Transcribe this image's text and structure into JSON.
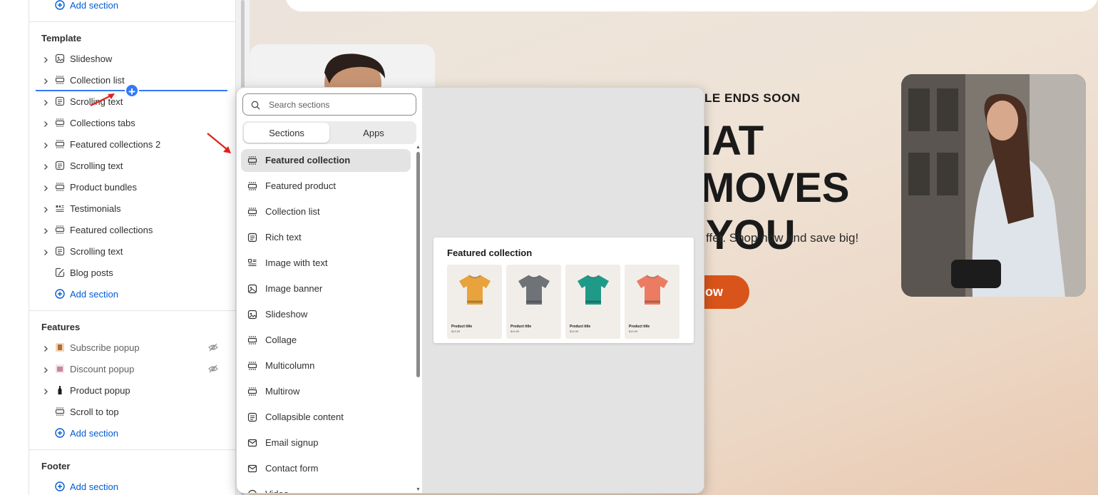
{
  "sidebar": {
    "top_add": "Add section",
    "template_heading": "Template",
    "template_items": [
      {
        "label": "Slideshow",
        "icon": "slideshow-icon"
      },
      {
        "label": "Collection list",
        "icon": "collection-list-icon"
      },
      {
        "label": "Scrolling text",
        "icon": "text-icon"
      },
      {
        "label": "Collections tabs",
        "icon": "collection-list-icon"
      },
      {
        "label": "Featured collections 2",
        "icon": "collection-list-icon"
      },
      {
        "label": "Scrolling text",
        "icon": "text-icon"
      },
      {
        "label": "Product bundles",
        "icon": "collection-list-icon"
      },
      {
        "label": "Testimonials",
        "icon": "testimonials-icon"
      },
      {
        "label": "Featured collections",
        "icon": "collection-list-icon"
      },
      {
        "label": "Scrolling text",
        "icon": "text-icon"
      },
      {
        "label": "Blog posts",
        "icon": "blog-icon"
      }
    ],
    "template_add": "Add section",
    "features_heading": "Features",
    "features_items": [
      {
        "label": "Subscribe popup",
        "hidden": true
      },
      {
        "label": "Discount popup",
        "hidden": true
      },
      {
        "label": "Product popup",
        "hidden": false
      },
      {
        "label": "Scroll to top",
        "hidden": false
      }
    ],
    "features_add": "Add section",
    "footer_heading": "Footer",
    "footer_add": "Add section"
  },
  "popup": {
    "search_placeholder": "Search sections",
    "tabs": [
      "Sections",
      "Apps"
    ],
    "items": [
      {
        "label": "Featured collection",
        "icon": "collection-icon"
      },
      {
        "label": "Featured product",
        "icon": "collection-icon"
      },
      {
        "label": "Collection list",
        "icon": "collection-icon"
      },
      {
        "label": "Rich text",
        "icon": "text-icon"
      },
      {
        "label": "Image with text",
        "icon": "image-text-icon"
      },
      {
        "label": "Image banner",
        "icon": "image-icon"
      },
      {
        "label": "Slideshow",
        "icon": "slideshow-icon"
      },
      {
        "label": "Collage",
        "icon": "collection-icon"
      },
      {
        "label": "Multicolumn",
        "icon": "collection-icon"
      },
      {
        "label": "Multirow",
        "icon": "collection-icon"
      },
      {
        "label": "Collapsible content",
        "icon": "text-icon"
      },
      {
        "label": "Email signup",
        "icon": "email-icon"
      },
      {
        "label": "Contact form",
        "icon": "email-icon"
      },
      {
        "label": "Video",
        "icon": "video-icon"
      }
    ],
    "selected_index": 0,
    "preview": {
      "title": "Featured collection",
      "products": [
        {
          "title": "Product title",
          "price": "$19.99",
          "color": "#e8a33c"
        },
        {
          "title": "Product title",
          "price": "$19.99",
          "color": "#6f7378"
        },
        {
          "title": "Product title",
          "price": "$19.99",
          "color": "#1f9a88"
        },
        {
          "title": "Product title",
          "price": "$19.99",
          "color": "#ec7b63"
        }
      ]
    }
  },
  "hero": {
    "kicker": "LE ENDS SOON",
    "title_line1": "IAT MOVES",
    "title_line2": "YOU",
    "subtitle": "ffer. Shop now and save big!",
    "button": "ow"
  },
  "colors": {
    "accent": "#005bd3",
    "drop_line": "#3478f6",
    "hero_button": "#d9541a",
    "annotation_arrow": "#e0201c"
  }
}
